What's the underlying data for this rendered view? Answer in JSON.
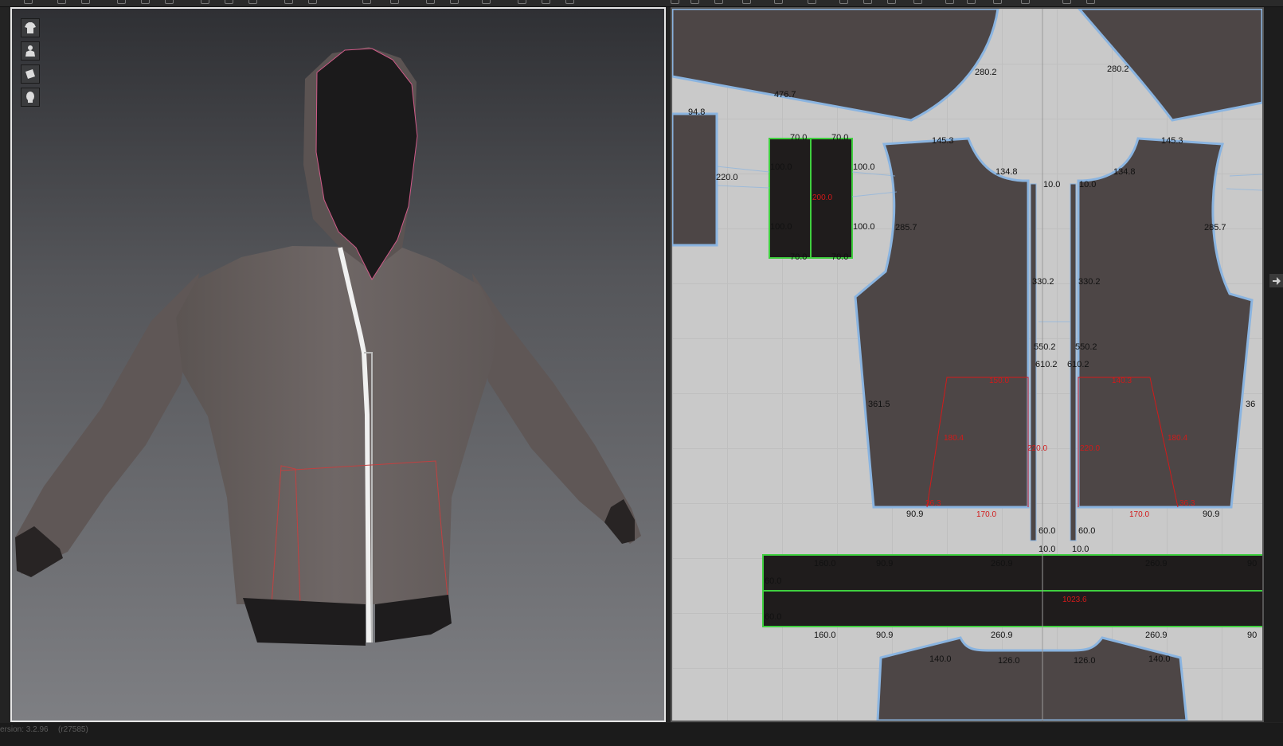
{
  "status": {
    "version": "ersion: 3.2.96",
    "revision": "(r27585)"
  },
  "view_buttons": [
    {
      "icon": "garment-icon"
    },
    {
      "icon": "avatar-icon"
    },
    {
      "icon": "texture-icon"
    },
    {
      "icon": "head-icon"
    }
  ],
  "pattern": {
    "labels": {
      "collar_top_left": "476.7",
      "armhole_left_top": "280.2",
      "armhole_right_top": "280.2",
      "left_edge_piece": "94.8",
      "left_piece_side": "220.0",
      "pocket_top_left": "70.0",
      "pocket_top_right": "70.0",
      "pocket_left_top": "100.0",
      "pocket_right_top": "100.0",
      "pocket_center": "200.0",
      "pocket_left_bottom": "100.0",
      "pocket_right_bottom": "100.0",
      "pocket_bot_left": "70.0",
      "pocket_bot_right": "70.0",
      "shoulder_left": "145.3",
      "shoulder_right": "145.3",
      "neck_left": "134.8",
      "neck_right": "134.8",
      "zip_top_left": "10.0",
      "zip_top_right": "10.0",
      "armhole_left": "285.7",
      "armhole_right": "285.7",
      "front_edge_left": "330.2",
      "front_edge_right": "330.2",
      "zip_mid_left": "550.2",
      "zip_mid_right": "550.2",
      "zip_len_left": "610.2",
      "zip_len_right": "610.2",
      "side_left": "361.5",
      "side_right": "36",
      "pocket_top_left_front": "150.0",
      "pocket_top_right_front": "140.3",
      "pocket_slant_left": "180.4",
      "pocket_slant_right": "180.4",
      "pocket_inner_left": "220.0",
      "pocket_inner_right": "220.0",
      "pocket_low_left": "36.3",
      "pocket_low_right": "36.3",
      "pocket_bottom_left": "170.0",
      "pocket_bottom_right": "170.0",
      "hem_left": "90.9",
      "hem_right": "90.9",
      "zip_end_left": "60.0",
      "zip_end_right": "60.0",
      "zip_tip_left": "10.0",
      "zip_tip_right": "10.0",
      "band_top_1": "160.0",
      "band_top_2": "90.9",
      "band_top_3": "260.9",
      "band_top_4": "260.9",
      "band_top_5": "90",
      "band_side_1": "60.0",
      "band_side_2": "60.0",
      "band_center": "1023.6",
      "band_bot_1": "160.0",
      "band_bot_2": "90.9",
      "band_bot_3": "260.9",
      "band_bot_4": "260.9",
      "band_bot_5": "90",
      "back_1": "140.0",
      "back_2": "126.0",
      "back_3": "126.0",
      "back_4": "140.0"
    }
  },
  "colors": {
    "fabric": "#4d4646",
    "rib": "#201d1d",
    "piece_outline": "#8ab4e0",
    "selected_outline": "#3fcf3f",
    "measure_red": "#d21a1a"
  }
}
